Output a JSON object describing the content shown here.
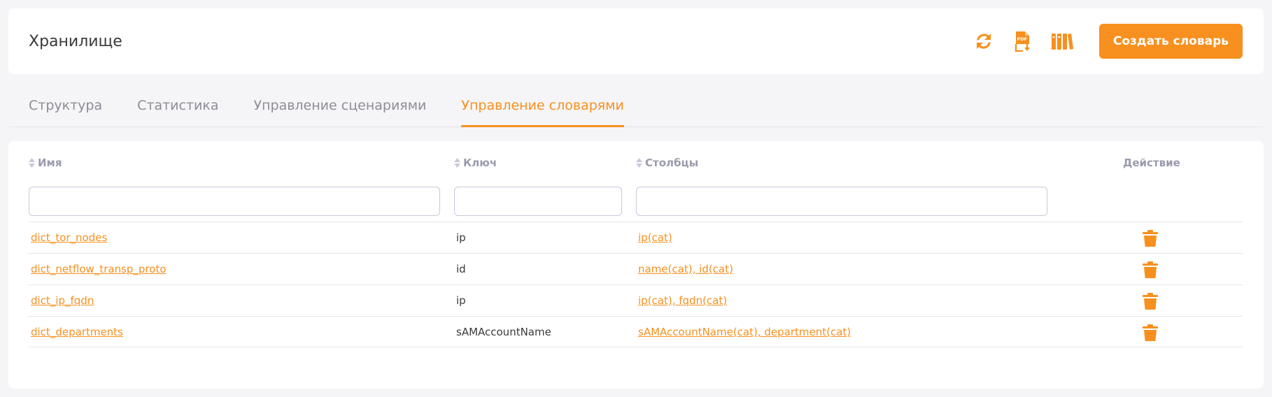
{
  "header": {
    "title": "Хранилище",
    "create_label": "Создать словарь",
    "icons": [
      "refresh-icon",
      "pdf-download-icon",
      "library-icon"
    ]
  },
  "tabs": [
    {
      "label": "Структура",
      "active": false
    },
    {
      "label": "Статистика",
      "active": false
    },
    {
      "label": "Управление сценариями",
      "active": false
    },
    {
      "label": "Управление словарями",
      "active": true
    }
  ],
  "table": {
    "columns": {
      "name": "Имя",
      "key": "Ключ",
      "cols": "Столбцы",
      "action": "Действие"
    },
    "filters": {
      "name": "",
      "key": "",
      "cols": ""
    },
    "rows": [
      {
        "name": "dict_tor_nodes",
        "key": "ip",
        "cols": "ip(cat)"
      },
      {
        "name": "dict_netflow_transp_proto",
        "key": "id",
        "cols": "name(cat), id(cat)"
      },
      {
        "name": "dict_ip_fqdn",
        "key": "ip",
        "cols": "ip(cat), fqdn(cat)"
      },
      {
        "name": "dict_departments",
        "key": "sAMAccountName",
        "cols": "sAMAccountName(cat), department(cat)"
      }
    ]
  },
  "colors": {
    "accent": "#f7901e",
    "header_text": "#9a9aae",
    "tab_inactive": "#8d8d98"
  }
}
